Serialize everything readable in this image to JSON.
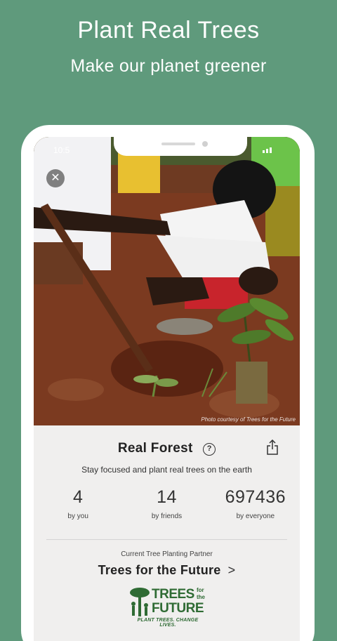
{
  "promo": {
    "headline": "Plant Real Trees",
    "subheadline": "Make our planet greener"
  },
  "status_bar": {
    "time": "10:5"
  },
  "photo": {
    "credit": "Photo courtesy of Trees for the Future"
  },
  "forest": {
    "title": "Real Forest",
    "help_icon": "question-circle-icon",
    "share_icon": "share-icon",
    "subtitle": "Stay focused and plant real trees on the earth"
  },
  "stats": [
    {
      "value": "4",
      "label": "by you"
    },
    {
      "value": "14",
      "label": "by friends"
    },
    {
      "value": "697436",
      "label": "by everyone"
    }
  ],
  "partner": {
    "caption": "Current Tree Planting Partner",
    "name": "Trees for the Future",
    "chevron": ">",
    "logo": {
      "word1": "TREES",
      "for": "for",
      "the": "the",
      "word2": "FUTURE",
      "tagline": "PLANT TREES. CHANGE LIVES."
    }
  },
  "colors": {
    "background": "#5f9a7c",
    "logo_green": "#2f6b34"
  }
}
